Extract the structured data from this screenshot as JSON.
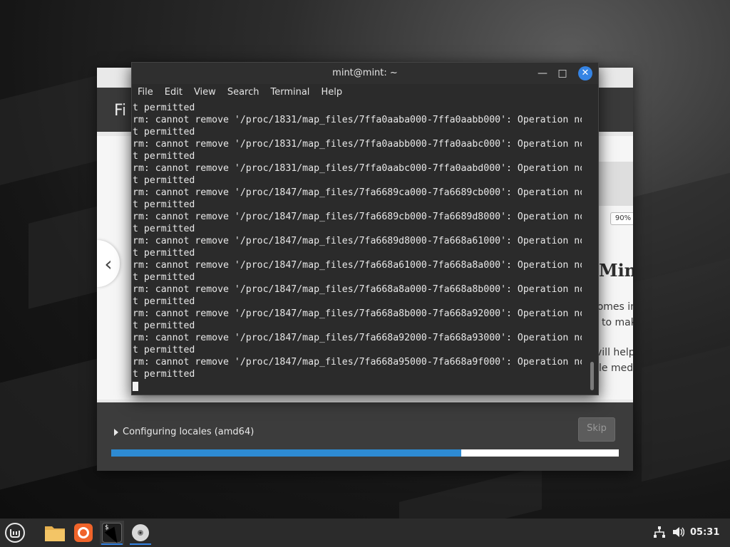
{
  "installer": {
    "title_fragment": "Fi",
    "slide_heading_fragment": "Min",
    "slide_lines": [
      "comes in",
      "to mak",
      "vill help",
      "le medi"
    ],
    "zoom": "90%",
    "prev_icon": "chevron-left-icon",
    "status_text": "Configuring locales (amd64)",
    "skip_label": "Skip",
    "progress_percent": 69
  },
  "terminal": {
    "title": "mint@mint: ~",
    "minimize_icon": "minimize-icon",
    "maximize_icon": "maximize-icon",
    "close_icon": "close-icon",
    "menu": [
      "File",
      "Edit",
      "View",
      "Search",
      "Terminal",
      "Help"
    ],
    "lines": [
      "t permitted",
      "rm: cannot remove '/proc/1831/map_files/7ffa0aaba000-7ffa0aabb000': Operation no",
      "t permitted",
      "rm: cannot remove '/proc/1831/map_files/7ffa0aabb000-7ffa0aabc000': Operation no",
      "t permitted",
      "rm: cannot remove '/proc/1831/map_files/7ffa0aabc000-7ffa0aabd000': Operation no",
      "t permitted",
      "rm: cannot remove '/proc/1847/map_files/7fa6689ca000-7fa6689cb000': Operation no",
      "t permitted",
      "rm: cannot remove '/proc/1847/map_files/7fa6689cb000-7fa6689d8000': Operation no",
      "t permitted",
      "rm: cannot remove '/proc/1847/map_files/7fa6689d8000-7fa668a61000': Operation no",
      "t permitted",
      "rm: cannot remove '/proc/1847/map_files/7fa668a61000-7fa668a8a000': Operation no",
      "t permitted",
      "rm: cannot remove '/proc/1847/map_files/7fa668a8a000-7fa668a8b000': Operation no",
      "t permitted",
      "rm: cannot remove '/proc/1847/map_files/7fa668a8b000-7fa668a92000': Operation no",
      "t permitted",
      "rm: cannot remove '/proc/1847/map_files/7fa668a92000-7fa668a93000': Operation no",
      "t permitted",
      "rm: cannot remove '/proc/1847/map_files/7fa668a95000-7fa668a9f000': Operation no",
      "t permitted"
    ]
  },
  "taskbar": {
    "apps": [
      {
        "name": "mint-menu-icon"
      },
      {
        "name": "files-folder-icon"
      },
      {
        "name": "firefox-icon"
      },
      {
        "name": "terminal-icon",
        "label": "$_"
      },
      {
        "name": "disc-icon"
      }
    ],
    "tray": [
      "network-icon",
      "volume-icon"
    ],
    "clock": "05:31"
  },
  "colors": {
    "accent": "#3584e4",
    "progress": "#2e8bd3",
    "terminal_bg": "#2b2b2b"
  }
}
